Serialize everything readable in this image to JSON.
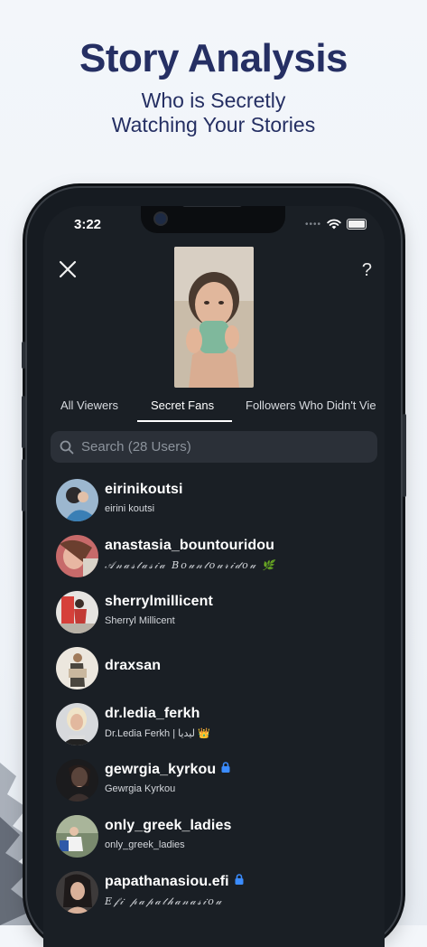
{
  "promo": {
    "title": "Story Analysis",
    "subtitle_line1": "Who is Secretly",
    "subtitle_line2": "Watching Your Stories"
  },
  "status_bar": {
    "time": "3:22",
    "icons": [
      "cellular-dots-icon",
      "wifi-icon",
      "battery-icon"
    ]
  },
  "header": {
    "close_icon": "close-icon",
    "help_label": "?"
  },
  "tabs": [
    {
      "label": "All Viewers",
      "active": false
    },
    {
      "label": "Secret Fans",
      "active": true
    },
    {
      "label": "Followers Who Didn't Vie",
      "active": false
    }
  ],
  "search": {
    "placeholder": "Search (28 Users)"
  },
  "users": [
    {
      "username": "eirinikoutsi",
      "full_name": "eirini koutsi"
    },
    {
      "username": "anastasia_bountouridou",
      "full_name": "𝒜𝓃𝒶𝓈𝓉𝒶𝓈𝒾𝒶 𝐵𝑜𝓊𝓃𝓉𝑜𝓊𝓇𝒾𝒹𝑜𝓊 🌿"
    },
    {
      "username": "sherrylmillicent",
      "full_name": "Sherryl Millicent"
    },
    {
      "username": "draxsan",
      "full_name": ""
    },
    {
      "username": "dr.ledia_ferkh",
      "full_name": "Dr.Ledia Ferkh | ليديا 👑"
    },
    {
      "username": "gewrgia_kyrkou",
      "full_name": "Gewrgia Kyrkou",
      "private": true
    },
    {
      "username": "only_greek_ladies",
      "full_name": "only_greek_ladies"
    },
    {
      "username": "papathanasiou.efi",
      "full_name": "𝐸𝒻𝒾 𝓅𝒶𝓅𝒶𝓉𝒽𝒶𝓃𝒶𝓈𝒾𝑜𝓊",
      "private": true
    }
  ],
  "colors": {
    "headline": "#252f63",
    "screen_bg": "#1a1f25",
    "search_bg": "#2b3038",
    "lock": "#3b8cff"
  }
}
